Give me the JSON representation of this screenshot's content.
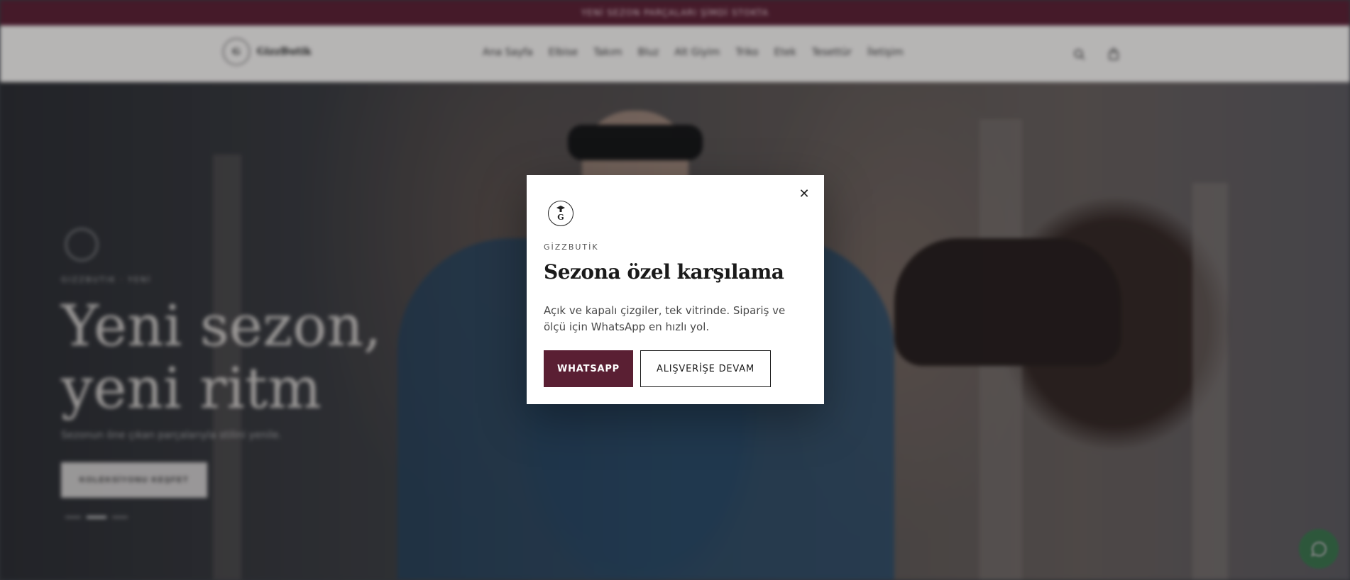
{
  "announcement": {
    "text": "YENİ SEZON PARÇALARI ŞİMDİ STOKTA"
  },
  "header": {
    "logo_text": "GizzButik",
    "nav": [
      "Ana Sayfa",
      "Elbise",
      "Takım",
      "Bluz",
      "Alt Giyim",
      "Triko",
      "Etek",
      "Tesettür",
      "İletişim"
    ]
  },
  "hero": {
    "kicker": "GIZZBUTIK · YENİ",
    "title_line1": "Yeni sezon,",
    "title_line2": "yeni ritm",
    "subtitle": "Sezonun öne çıkan parçalarıyla stilini yenile.",
    "cta": "KOLEKSİYONU KEŞFET"
  },
  "modal": {
    "brand": "GİZZBUTİK",
    "title": "Sezona özel karşılama",
    "body": "Açık ve kapalı çizgiler, tek vitrinde. Sipariş ve ölçü için WhatsApp en hızlı yol.",
    "primary_button": "WHATSAPP",
    "secondary_button": "ALIŞVERİŞE DEVAM",
    "close_glyph": "✕",
    "logo_letter": "G"
  },
  "colors": {
    "brand": "#5a1f33",
    "whatsapp": "#1f8a3f"
  },
  "icons": {
    "search": "search-icon",
    "cart": "bag-icon",
    "close": "close-icon",
    "whatsapp": "whatsapp-icon"
  }
}
